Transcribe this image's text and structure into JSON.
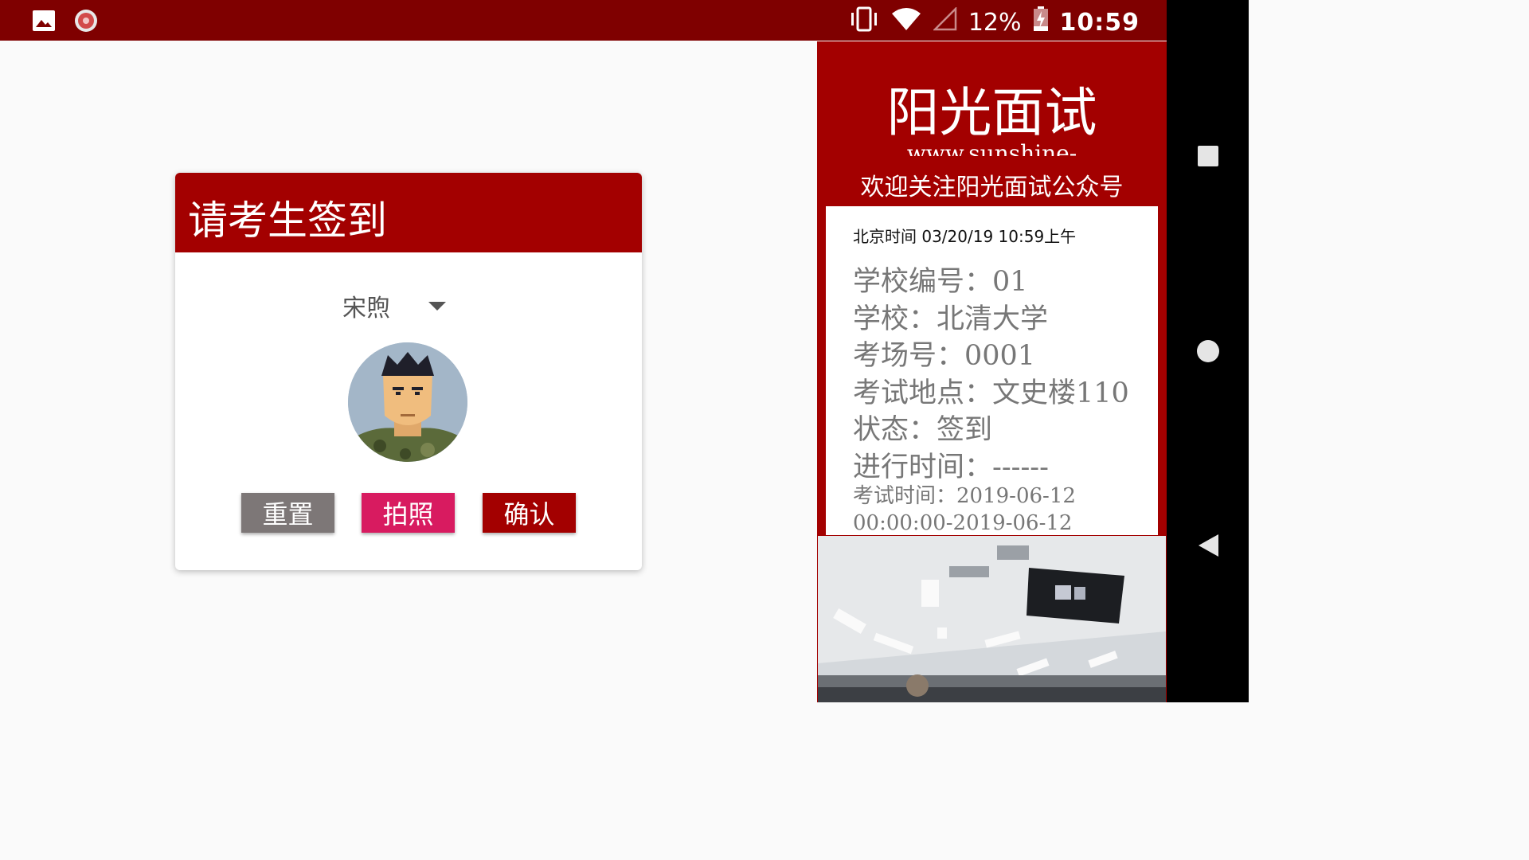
{
  "status_bar": {
    "battery": "12%",
    "time": "10:59",
    "left_icons": [
      "image-icon",
      "app-badge-icon"
    ],
    "right_icons": [
      "vibrate-icon",
      "wifi-icon",
      "signal-icon",
      "battery-charging-icon"
    ]
  },
  "checkin": {
    "title": "请考生签到",
    "selected_name": "宋煦",
    "buttons": {
      "reset": "重置",
      "photo": "拍照",
      "confirm": "确认"
    }
  },
  "panel": {
    "title": "阳光面试",
    "url_partial": "www.sunshine-",
    "follow": "欢迎关注阳光面试公众号",
    "clock": "北京时间 03/20/19 10:59上午",
    "info": [
      "学校编号：01",
      "学校：北清大学",
      "考场号：0001",
      "考试地点：文史楼110",
      "状态：签到",
      "进行时间：------"
    ],
    "exam_time": "考试时间：2019-06-12 00:00:00-2019-06-12"
  },
  "nav": {
    "icons": [
      "recents-icon",
      "home-icon",
      "back-icon"
    ]
  },
  "colors": {
    "status_bar": "#7f0000",
    "accent": "#a30000",
    "photo_button": "#d81b60",
    "reset_button": "#7d7777"
  }
}
